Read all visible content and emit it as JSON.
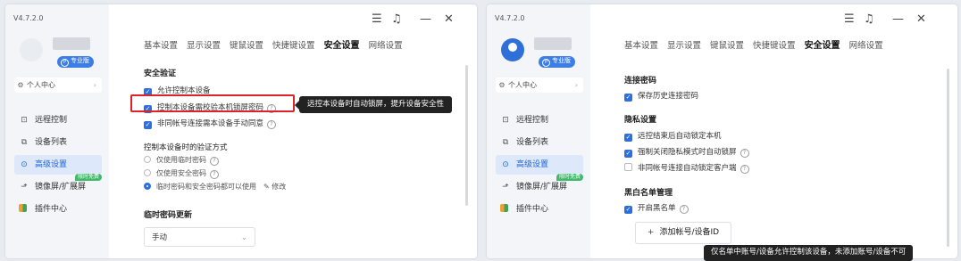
{
  "left": {
    "version": "V4.7.2.0",
    "badge": "专业版",
    "personal_center": "个人中心",
    "nav": [
      "远程控制",
      "设备列表",
      "高级设置",
      "镜像屏/扩展屏",
      "插件中心"
    ],
    "hot_badge": "限时免费",
    "tabs": [
      "基本设置",
      "显示设置",
      "键鼠设置",
      "快捷键设置",
      "安全设置",
      "网络设置"
    ],
    "section_security": "安全验证",
    "opt_allow": "允许控制本设备",
    "opt_lock": "控制本设备需校验本机锁屏密码",
    "opt_nonsame": "非同帐号连接需本设备手动同意",
    "tooltip": "远控本设备时自动锁屏，提升设备安全性",
    "section_verify": "控制本设备时的验证方式",
    "radio_temp": "仅使用临时密码",
    "radio_safe": "仅使用安全密码",
    "radio_both": "临时密码和安全密码都可以使用",
    "modify": "修改",
    "section_temp_update": "临时密码更新",
    "select_value": "手动"
  },
  "right": {
    "version": "V4.7.2.0",
    "badge": "专业版",
    "personal_center": "个人中心",
    "nav": [
      "远程控制",
      "设备列表",
      "高级设置",
      "镜像屏/扩展屏",
      "插件中心"
    ],
    "hot_badge": "限时免费",
    "tabs": [
      "基本设置",
      "显示设置",
      "键鼠设置",
      "快捷键设置",
      "安全设置",
      "网络设置"
    ],
    "section_conn_pwd": "连接密码",
    "opt_save_pwd": "保存历史连接密码",
    "section_privacy": "隐私设置",
    "opt_lock_after": "远控结束后自动锁定本机",
    "opt_force_lock": "强制关闭隐私模式时自动锁屏",
    "opt_nonsame_lock": "非同帐号连接自动锁定客户端",
    "section_blacklist": "黑白名单管理",
    "opt_blacklist": "开启黑名单",
    "add_button": "添加帐号/设备ID",
    "tooltip": "仅名单中账号/设备允许控制该设备，未添加账号/设备不可"
  },
  "icons": {
    "menu": "menu-icon",
    "bell": "bell-icon",
    "minimize": "minimize-icon",
    "close": "close-icon"
  },
  "colors": {
    "accent": "#2d6fdf",
    "highlight": "#d9242a",
    "sidebar": "#f3f5f8"
  }
}
